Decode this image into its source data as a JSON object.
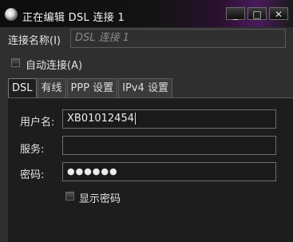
{
  "window": {
    "title": "正在编辑 DSL 连接 1",
    "controls": {
      "minimize": "_",
      "maximize": "□",
      "close": "✕"
    }
  },
  "connection": {
    "name_label": "连接名称(I)",
    "name_value": "DSL 连接 1",
    "auto_connect_label": "自动连接(A)"
  },
  "tabs": [
    {
      "label": "DSL",
      "active": true
    },
    {
      "label": "有线",
      "active": false
    },
    {
      "label": "PPP 设置",
      "active": false
    },
    {
      "label": "IPv4 设置",
      "active": false
    }
  ],
  "dsl": {
    "username_label": "用户名:",
    "username_value": "XB01012454",
    "service_label": "服务:",
    "service_value": "",
    "password_label": "密码:",
    "password_value": "●●●●●●",
    "show_password_label": "显示密码"
  }
}
